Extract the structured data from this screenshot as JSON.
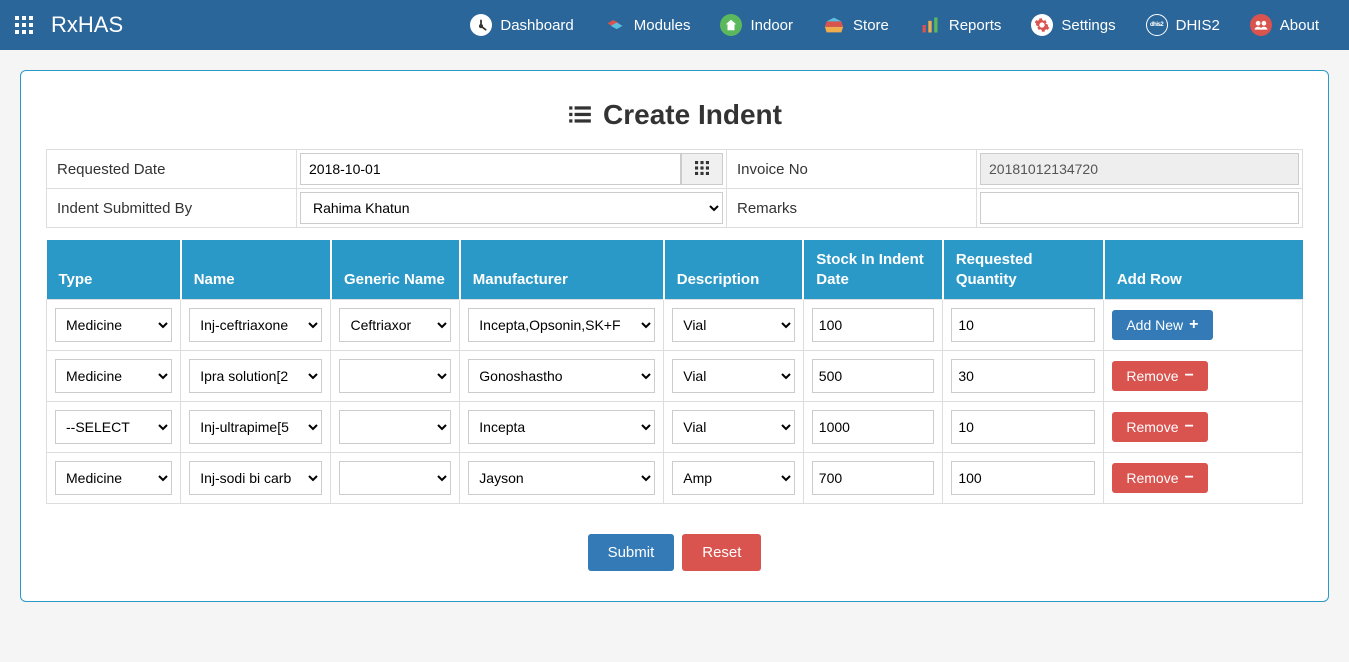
{
  "brand": "RxHAS",
  "nav": [
    {
      "label": "Dashboard",
      "key": "dashboard"
    },
    {
      "label": "Modules",
      "key": "modules"
    },
    {
      "label": "Indoor",
      "key": "indoor"
    },
    {
      "label": "Store",
      "key": "store"
    },
    {
      "label": "Reports",
      "key": "reports"
    },
    {
      "label": "Settings",
      "key": "settings"
    },
    {
      "label": "DHIS2",
      "key": "dhis2"
    },
    {
      "label": "About",
      "key": "about"
    }
  ],
  "title": "Create Indent",
  "form": {
    "requested_date_label": "Requested Date",
    "requested_date_value": "2018-10-01",
    "invoice_no_label": "Invoice No",
    "invoice_no_value": "20181012134720",
    "submitted_by_label": "Indent Submitted By",
    "submitted_by_value": "Rahima Khatun",
    "remarks_label": "Remarks",
    "remarks_value": ""
  },
  "columns": {
    "type": "Type",
    "name": "Name",
    "generic": "Generic Name",
    "manufacturer": "Manufacturer",
    "description": "Description",
    "stock": "Stock In Indent Date",
    "qty": "Requested Quantity",
    "action": "Add Row"
  },
  "rows": [
    {
      "type": "Medicine",
      "name": "Inj-ceftriaxone",
      "generic": "Ceftriaxor",
      "manufacturer": "Incepta,Opsonin,SK+F",
      "description": "Vial",
      "stock": "100",
      "qty": "10",
      "action": "Add New",
      "action_kind": "add"
    },
    {
      "type": "Medicine",
      "name": "Ipra solution[2",
      "generic": "",
      "manufacturer": "Gonoshastho",
      "description": "Vial",
      "stock": "500",
      "qty": "30",
      "action": "Remove",
      "action_kind": "remove"
    },
    {
      "type": "--SELECT",
      "name": "Inj-ultrapime[5",
      "generic": "",
      "manufacturer": "Incepta",
      "description": "Vial",
      "stock": "1000",
      "qty": "10",
      "action": "Remove",
      "action_kind": "remove"
    },
    {
      "type": "Medicine",
      "name": "Inj-sodi bi carb",
      "generic": "",
      "manufacturer": "Jayson",
      "description": "Amp",
      "stock": "700",
      "qty": "100",
      "action": "Remove",
      "action_kind": "remove"
    }
  ],
  "buttons": {
    "submit": "Submit",
    "reset": "Reset"
  }
}
